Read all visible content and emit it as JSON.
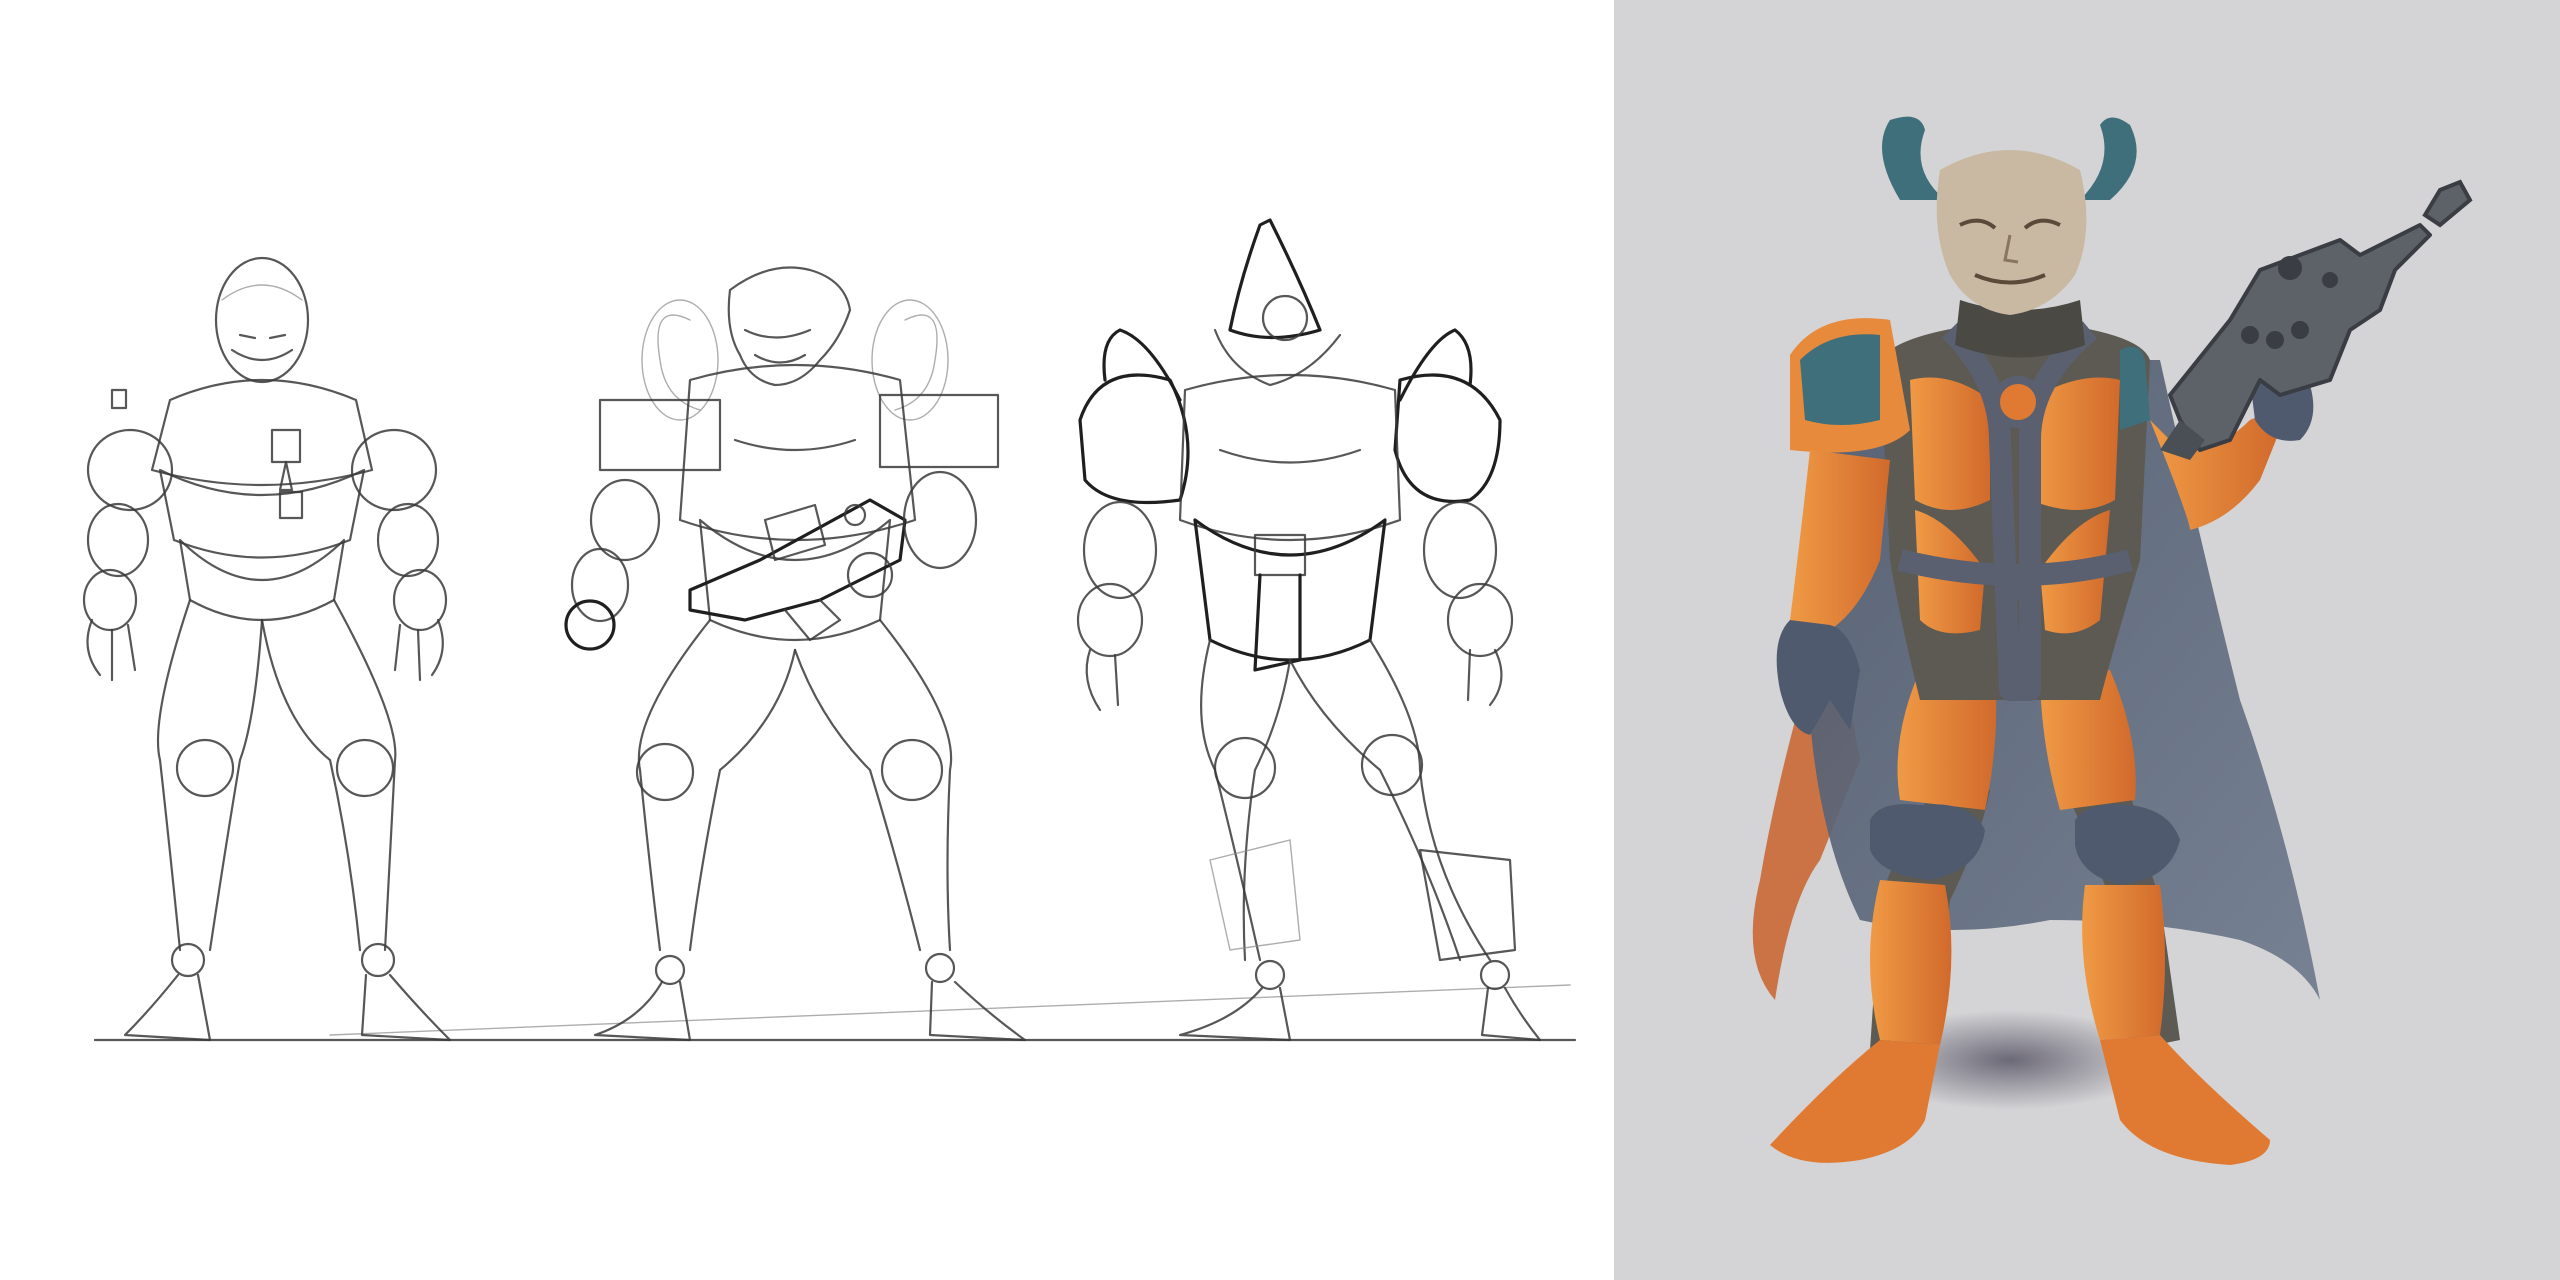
{
  "image": {
    "left_panel": {
      "background": "#ffffff",
      "sketches": [
        "rough-sketch-1",
        "rough-sketch-2",
        "rough-sketch-3"
      ]
    },
    "right_panel": {
      "background": "#d4d4d6",
      "subject": "painted-character"
    },
    "colors": {
      "armor_orange": "#e88a3c",
      "armor_shade": "#c9622a",
      "suit_dark": "#5c5a52",
      "strap_slate": "#5a6070",
      "horn_teal": "#3f6f7a",
      "cape": "#5b6678",
      "skin": "#c9b9a2"
    }
  }
}
